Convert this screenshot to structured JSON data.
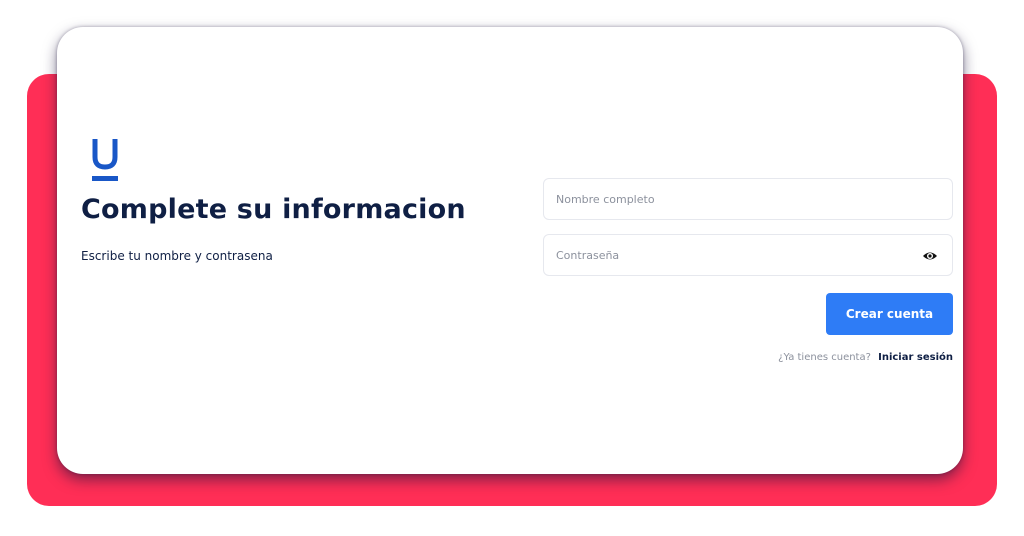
{
  "colors": {
    "backdrop": "#ff2e56",
    "brand_blue": "#1957c7",
    "title_text": "#0f1f44",
    "primary_button": "#2e7cf6"
  },
  "header": {
    "logo_icon": "u-logo-icon",
    "title": "Complete su informacion",
    "subtitle": "Escribe tu nombre y contrasena"
  },
  "form": {
    "name_placeholder": "Nombre completo",
    "password_placeholder": "Contraseña",
    "password_toggle_icon": "eye-icon",
    "submit_label": "Crear cuenta"
  },
  "footer": {
    "login_prompt": "¿Ya tienes cuenta?",
    "login_link": "Iniciar sesión"
  }
}
